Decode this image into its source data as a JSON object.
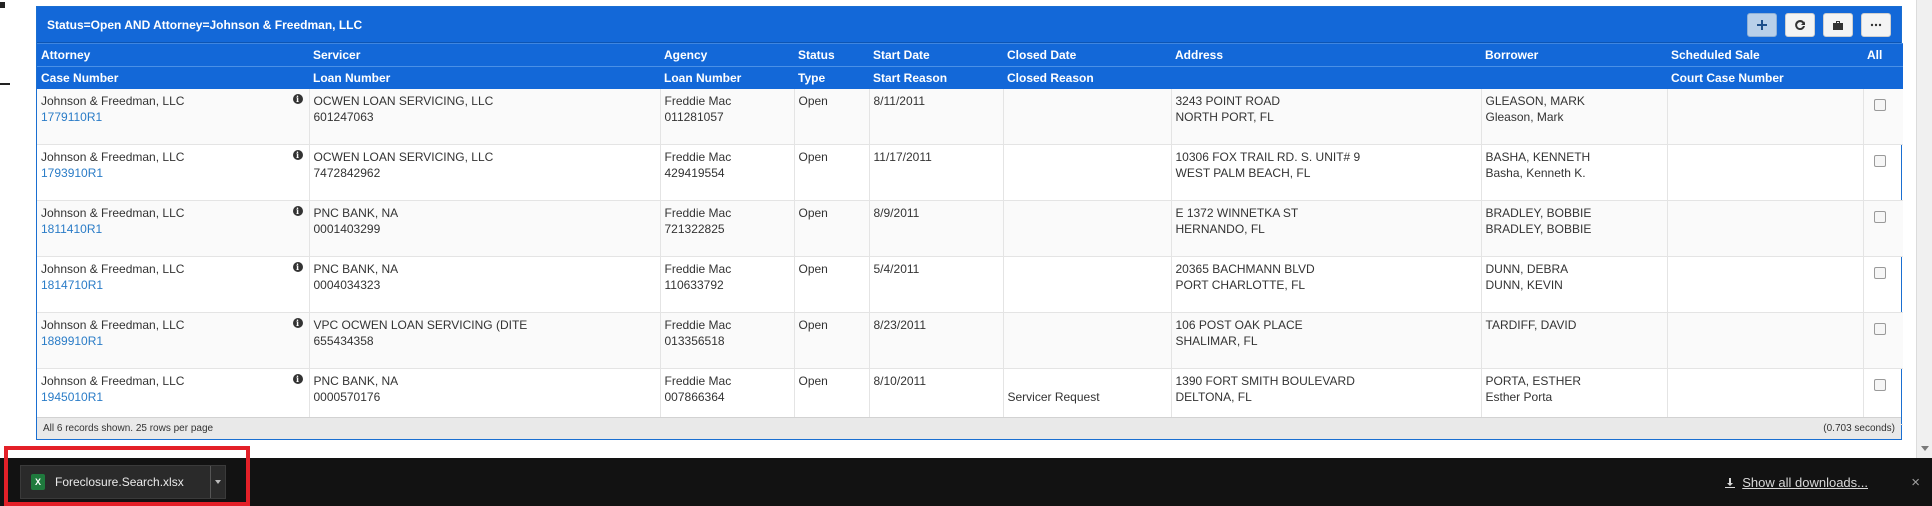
{
  "panel": {
    "title": "Status=Open AND Attorney=Johnson & Freedman, LLC",
    "toolbar": [
      {
        "name": "add",
        "icon": "plus-icon"
      },
      {
        "name": "refresh",
        "icon": "refresh-icon"
      },
      {
        "name": "briefcase",
        "icon": "briefcase-icon"
      },
      {
        "name": "more",
        "icon": "ellipsis-icon"
      }
    ]
  },
  "headers": {
    "row1": [
      "Attorney",
      "Servicer",
      "Agency",
      "Status",
      "Start Date",
      "Closed Date",
      "Address",
      "Borrower",
      "Scheduled Sale",
      "All"
    ],
    "row2": [
      "Case Number",
      "Loan Number",
      "Loan Number",
      "Type",
      "Start Reason",
      "Closed Reason",
      "",
      "",
      "Court Case Number",
      ""
    ]
  },
  "rows": [
    {
      "attorney": "Johnson & Freedman, LLC",
      "case_number": "1779110R1",
      "servicer": "OCWEN LOAN SERVICING, LLC",
      "loan_number": "601247063",
      "agency": "Freddie Mac",
      "agency_loan": "011281057",
      "status": "Open",
      "start_date": "8/11/2011",
      "closed_reason": "",
      "address1": "3243 POINT ROAD",
      "address2": "NORTH PORT, FL",
      "borrower1": "GLEASON, MARK",
      "borrower2": "Gleason, Mark"
    },
    {
      "attorney": "Johnson & Freedman, LLC",
      "case_number": "1793910R1",
      "servicer": "OCWEN LOAN SERVICING, LLC",
      "loan_number": "7472842962",
      "agency": "Freddie Mac",
      "agency_loan": "429419554",
      "status": "Open",
      "start_date": "11/17/2011",
      "closed_reason": "",
      "address1": "10306 FOX TRAIL RD. S. UNIT# 9",
      "address2": "WEST PALM BEACH, FL",
      "borrower1": "BASHA, KENNETH",
      "borrower2": "Basha, Kenneth K."
    },
    {
      "attorney": "Johnson & Freedman, LLC",
      "case_number": "1811410R1",
      "servicer": "PNC BANK, NA",
      "loan_number": "0001403299",
      "agency": "Freddie Mac",
      "agency_loan": "721322825",
      "status": "Open",
      "start_date": "8/9/2011",
      "closed_reason": "",
      "address1": "E 1372 WINNETKA ST",
      "address2": "HERNANDO, FL",
      "borrower1": "BRADLEY, BOBBIE",
      "borrower2": "BRADLEY, BOBBIE"
    },
    {
      "attorney": "Johnson & Freedman, LLC",
      "case_number": "1814710R1",
      "servicer": "PNC BANK, NA",
      "loan_number": "0004034323",
      "agency": "Freddie Mac",
      "agency_loan": "110633792",
      "status": "Open",
      "start_date": "5/4/2011",
      "closed_reason": "",
      "address1": "20365 BACHMANN BLVD",
      "address2": "PORT CHARLOTTE, FL",
      "borrower1": "DUNN, DEBRA",
      "borrower2": "DUNN, KEVIN"
    },
    {
      "attorney": "Johnson & Freedman, LLC",
      "case_number": "1889910R1",
      "servicer": "VPC OCWEN LOAN SERVICING (DITE",
      "loan_number": "655434358",
      "agency": "Freddie Mac",
      "agency_loan": "013356518",
      "status": "Open",
      "start_date": "8/23/2011",
      "closed_reason": "",
      "address1": "106 POST OAK PLACE",
      "address2": "SHALIMAR, FL",
      "borrower1": "TARDIFF, DAVID",
      "borrower2": ""
    },
    {
      "attorney": "Johnson & Freedman, LLC",
      "case_number": "1945010R1",
      "servicer": "PNC BANK, NA",
      "loan_number": "0000570176",
      "agency": "Freddie Mac",
      "agency_loan": "007866364",
      "status": "Open",
      "start_date": "8/10/2011",
      "closed_reason": "Servicer Request",
      "address1": "1390 FORT SMITH BOULEVARD",
      "address2": "DELTONA, FL",
      "borrower1": "PORTA, ESTHER",
      "borrower2": "Esther Porta"
    }
  ],
  "footer": {
    "left": "All 6 records shown. 25 rows per page",
    "right": "(0.703 seconds)"
  },
  "download_bar": {
    "file_name": "Foreclosure.Search.xlsx",
    "file_icon": "excel-file-icon",
    "show_all": "Show all downloads...",
    "close": "×"
  }
}
